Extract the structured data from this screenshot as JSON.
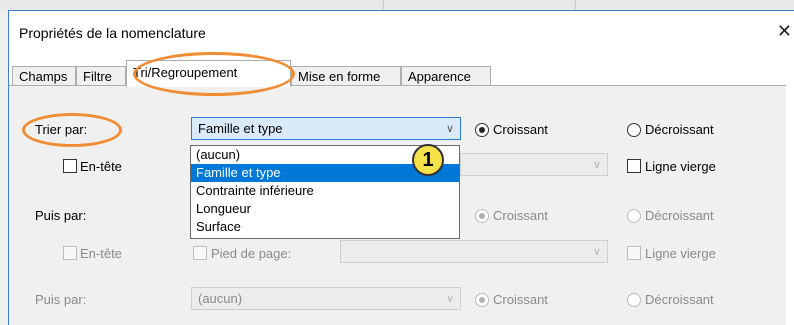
{
  "window": {
    "title": "Propriétés de la nomenclature",
    "close_symbol": "✕"
  },
  "tabs": [
    "Champs",
    "Filtre",
    "Tri/Regroupement",
    "Mise en forme",
    "Apparence"
  ],
  "active_tab": "Tri/Regroupement",
  "sort1": {
    "label": "Trier par:",
    "value": "Famille et type",
    "asc": "Croissant",
    "desc": "Décroissant",
    "header": "En-tête",
    "blank_line": "Ligne vierge"
  },
  "dropdown": {
    "options": [
      "(aucun)",
      "Famille et type",
      "Contrainte inférieure",
      "Longueur",
      "Surface"
    ],
    "selected_index": 1
  },
  "sort2": {
    "label": "Puis par:",
    "asc": "Croissant",
    "desc": "Décroissant",
    "header": "En-tête",
    "footer": "Pied de page:",
    "blank_line": "Ligne vierge"
  },
  "sort3": {
    "label": "Puis par:",
    "value": "(aucun)",
    "asc": "Croissant",
    "desc": "Décroissant"
  },
  "callout": {
    "number": "1",
    "color": "#f08c33"
  }
}
